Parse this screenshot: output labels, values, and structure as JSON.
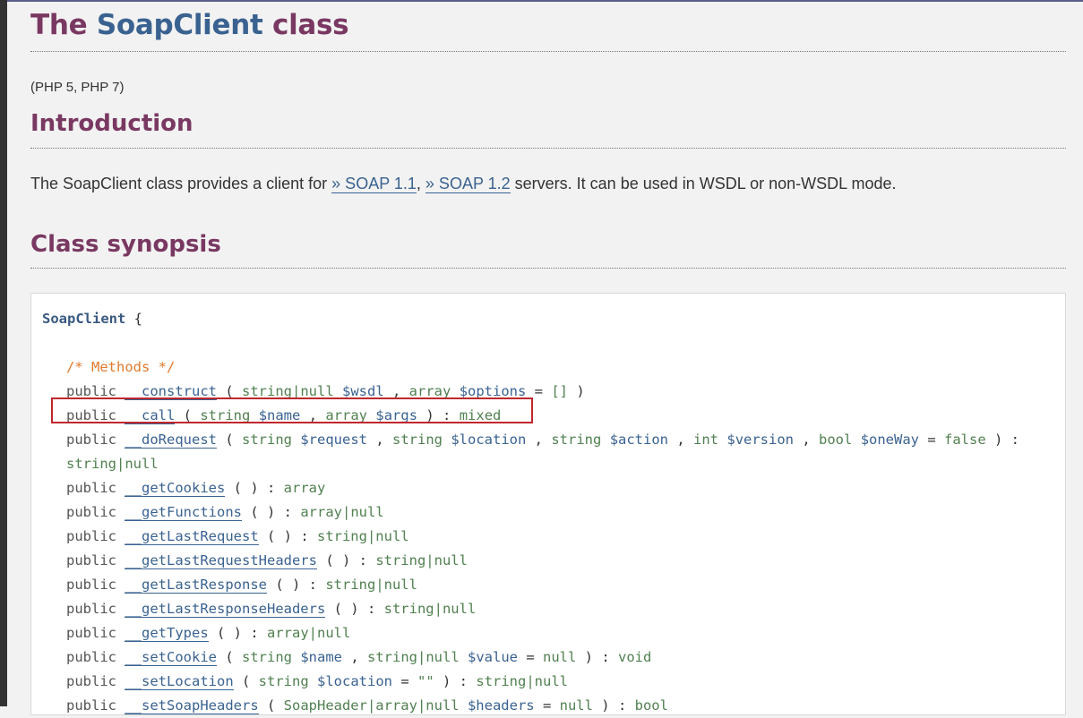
{
  "page": {
    "title_prefix": "The ",
    "title_class": "SoapClient",
    "title_suffix": " class",
    "versions": "(PHP 5, PHP 7)"
  },
  "intro": {
    "heading": "Introduction",
    "text_before": "The SoapClient class provides a client for ",
    "link1": "» SOAP 1.1",
    "sep": ", ",
    "link2": "» SOAP 1.2",
    "text_after": " servers. It can be used in WSDL or non-WSDL mode."
  },
  "synopsis": {
    "heading": "Class synopsis",
    "class_name": "SoapClient",
    "open_brace": " {",
    "methods_comment": "/* Methods */"
  }
}
